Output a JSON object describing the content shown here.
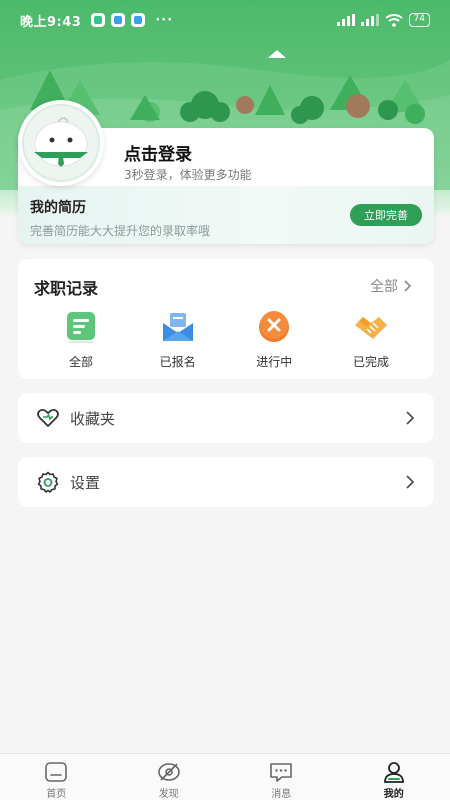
{
  "status_bar": {
    "time": "晚上9:43",
    "dots": "···",
    "battery": "74"
  },
  "login": {
    "title": "点击登录",
    "subtitle": "3秒登录，体验更多功能"
  },
  "resume": {
    "title": "我的简历",
    "subtitle": "完善简历能大大提升您的录取率哦",
    "button": "立即完善"
  },
  "job_records": {
    "title": "求职记录",
    "all_link": "全部",
    "items": [
      {
        "label": "全部",
        "icon": "document-icon"
      },
      {
        "label": "已报名",
        "icon": "envelope-icon"
      },
      {
        "label": "进行中",
        "icon": "close-circle-icon"
      },
      {
        "label": "已完成",
        "icon": "handshake-icon"
      }
    ]
  },
  "menu": {
    "favorites": "收藏夹",
    "settings": "设置"
  },
  "tabbar": {
    "items": [
      {
        "label": "首页",
        "icon": "home-icon"
      },
      {
        "label": "发现",
        "icon": "discover-icon"
      },
      {
        "label": "消息",
        "icon": "message-icon"
      },
      {
        "label": "我的",
        "icon": "profile-icon"
      }
    ],
    "active": 3
  },
  "colors": {
    "brand_green": "#2f9e57",
    "header_green": "#4cb96a"
  }
}
